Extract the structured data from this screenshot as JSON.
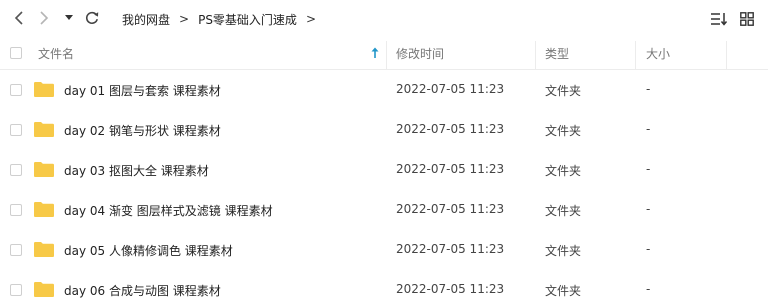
{
  "breadcrumb": {
    "items": [
      "我的网盘",
      "PS零基础入门速成"
    ],
    "separator": ">"
  },
  "icons": {
    "back": "chevron-left-icon",
    "forward": "chevron-right-icon",
    "history": "caret-down-icon",
    "refresh": "refresh-icon",
    "sort": "sort-list-icon",
    "view": "grid-view-icon",
    "sort_indicator": "arrow-up-icon",
    "folder": "folder-icon"
  },
  "colors": {
    "folder": "#f7c948",
    "sort_indicator": "#2196c9"
  },
  "columns": {
    "name": "文件名",
    "modified": "修改时间",
    "type": "类型",
    "size": "大小"
  },
  "files": [
    {
      "name": "day 01 图层与套索 课程素材",
      "modified": "2022-07-05 11:23",
      "type": "文件夹",
      "size": "-"
    },
    {
      "name": "day 02 钢笔与形状 课程素材",
      "modified": "2022-07-05 11:23",
      "type": "文件夹",
      "size": "-"
    },
    {
      "name": "day 03 抠图大全 课程素材",
      "modified": "2022-07-05 11:23",
      "type": "文件夹",
      "size": "-"
    },
    {
      "name": "day 04 渐变 图层样式及滤镜 课程素材",
      "modified": "2022-07-05 11:23",
      "type": "文件夹",
      "size": "-"
    },
    {
      "name": "day 05 人像精修调色 课程素材",
      "modified": "2022-07-05 11:23",
      "type": "文件夹",
      "size": "-"
    },
    {
      "name": "day 06 合成与动图 课程素材",
      "modified": "2022-07-05 11:23",
      "type": "文件夹",
      "size": "-"
    }
  ]
}
